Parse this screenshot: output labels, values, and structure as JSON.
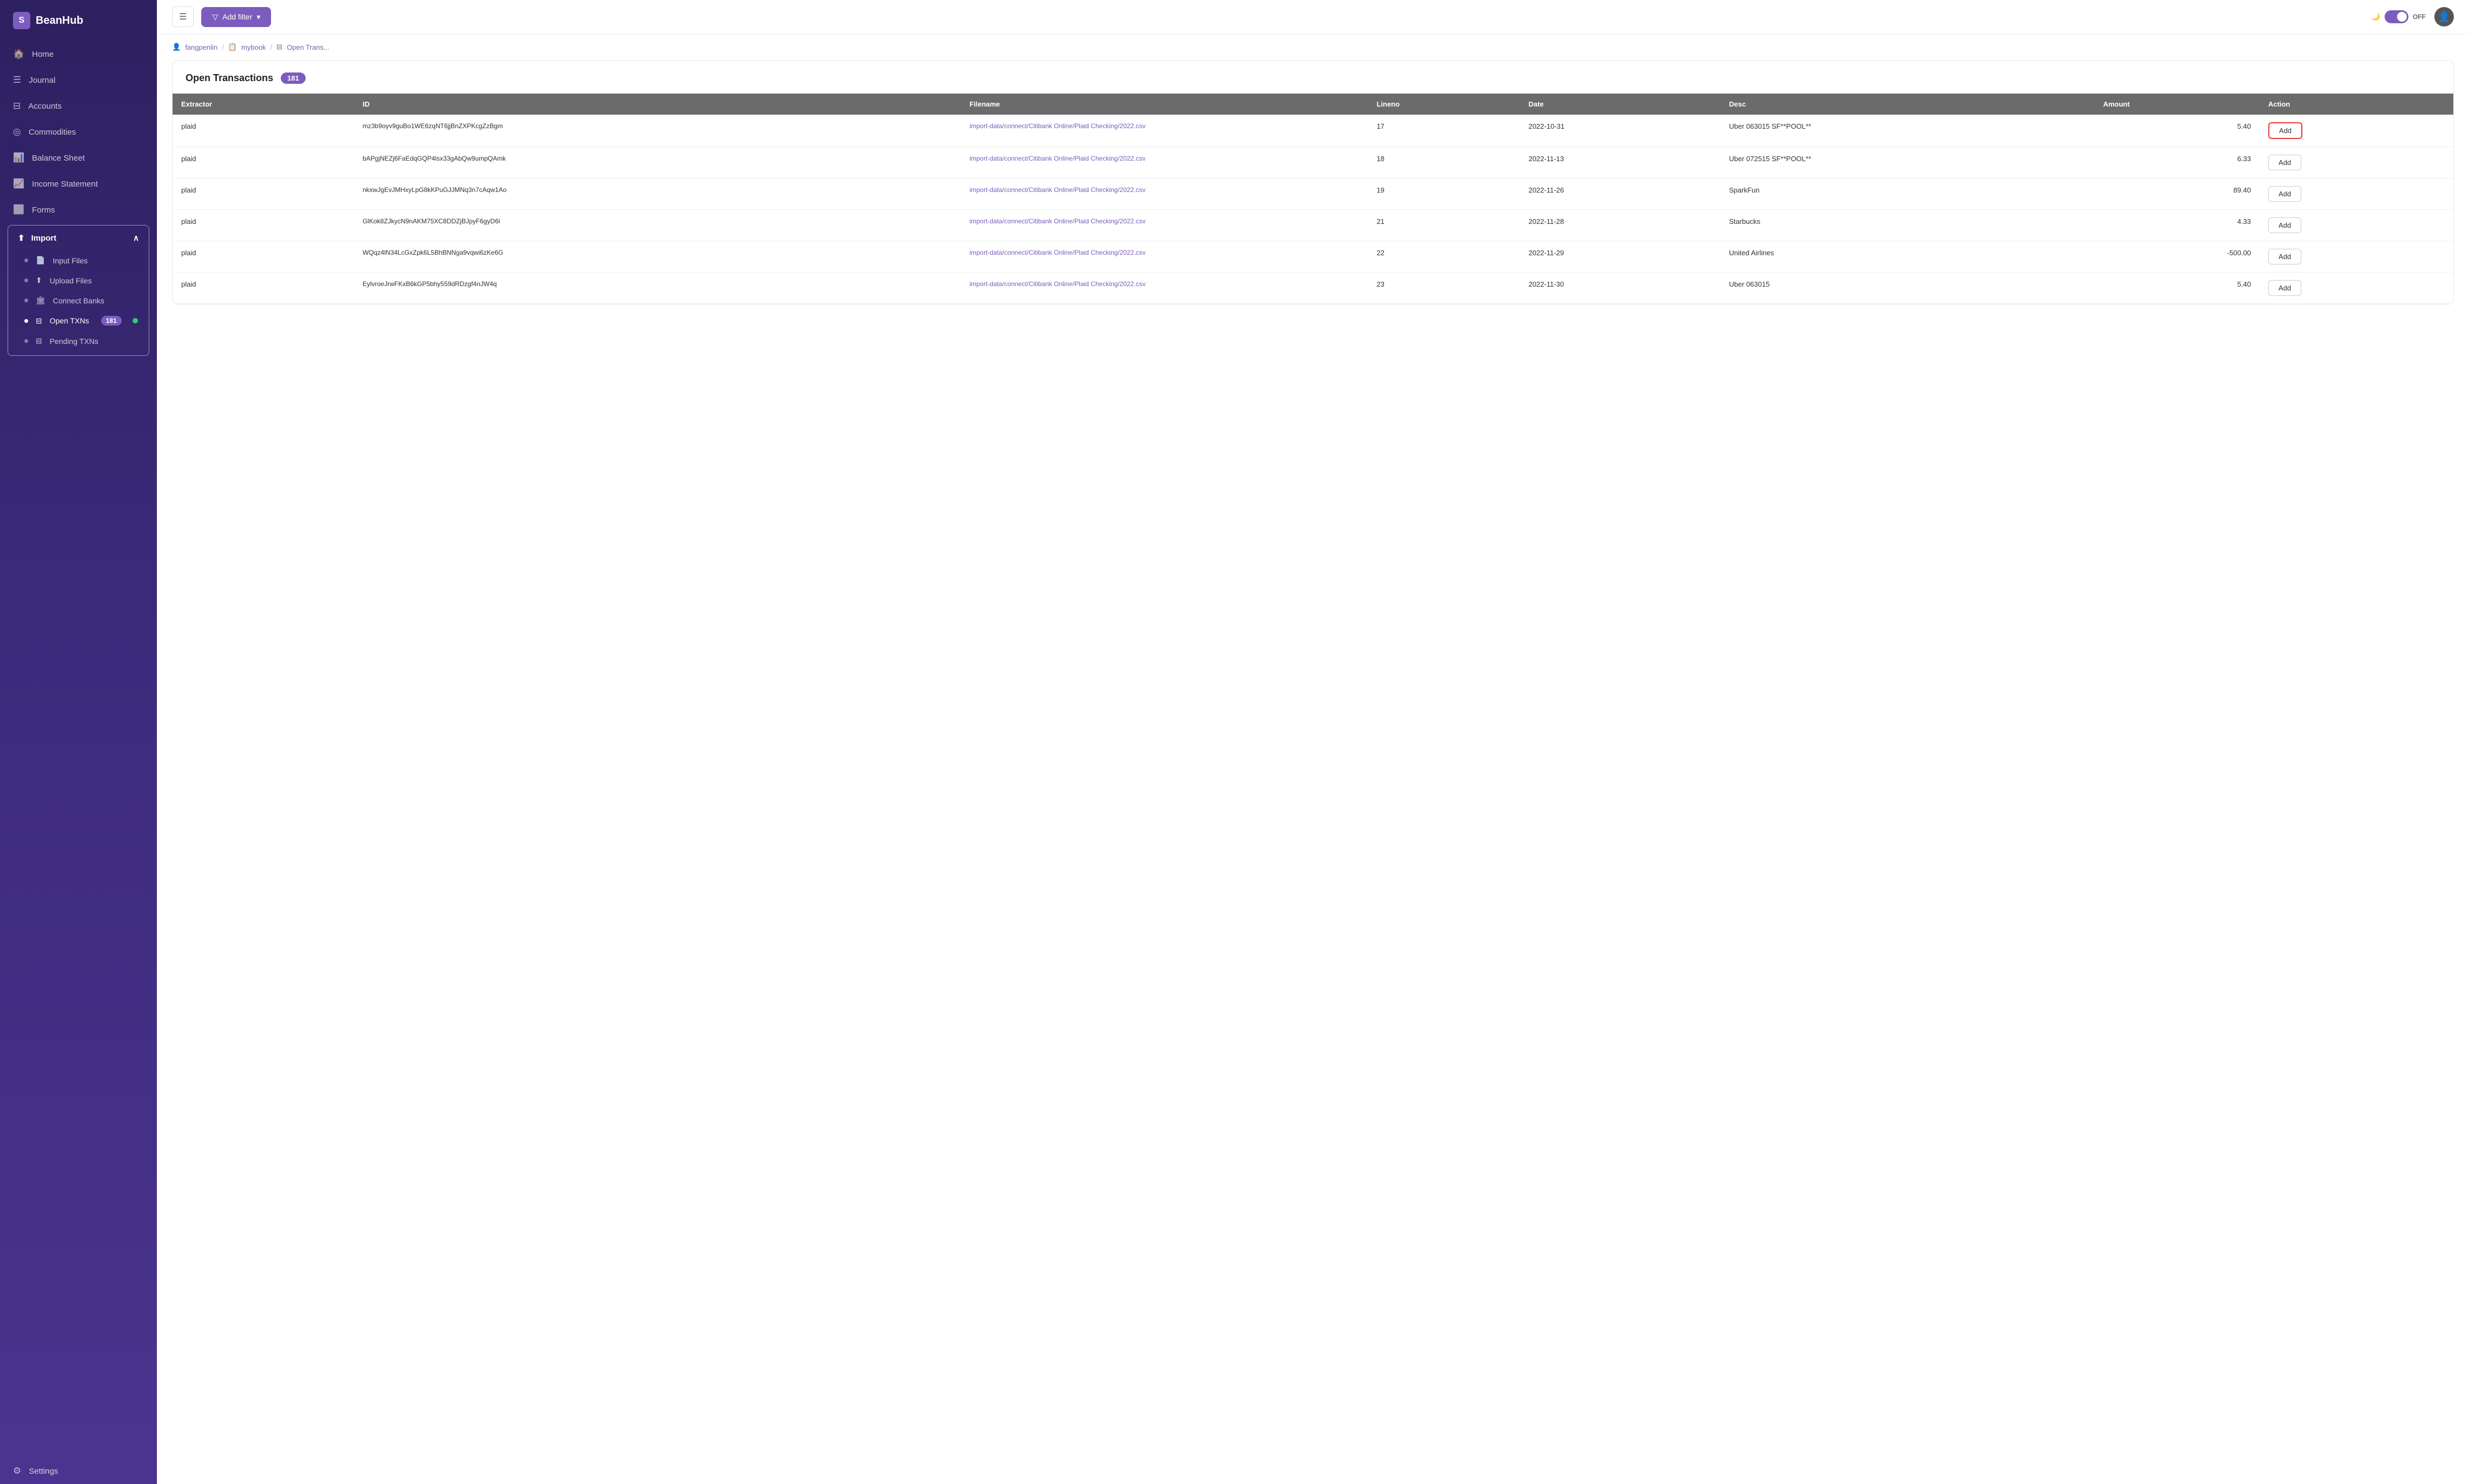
{
  "app": {
    "name": "BeanHub"
  },
  "sidebar": {
    "nav_items": [
      {
        "id": "home",
        "label": "Home",
        "icon": "🏠"
      },
      {
        "id": "journal",
        "label": "Journal",
        "icon": "☰"
      },
      {
        "id": "accounts",
        "label": "Accounts",
        "icon": "⊟"
      },
      {
        "id": "commodities",
        "label": "Commodities",
        "icon": "◎"
      },
      {
        "id": "balance-sheet",
        "label": "Balance Sheet",
        "icon": "📊"
      },
      {
        "id": "income-statement",
        "label": "Income Statement",
        "icon": "📈"
      },
      {
        "id": "forms",
        "label": "Forms",
        "icon": "⬜"
      }
    ],
    "import": {
      "label": "Import",
      "icon": "⬆",
      "sub_items": [
        {
          "id": "input-files",
          "label": "Input Files",
          "icon": "📄"
        },
        {
          "id": "upload-files",
          "label": "Upload Files",
          "icon": "⬆"
        },
        {
          "id": "connect-banks",
          "label": "Connect Banks",
          "icon": "🏛"
        },
        {
          "id": "open-txns",
          "label": "Open TXNs",
          "badge": "181",
          "active": true
        },
        {
          "id": "pending-txns",
          "label": "Pending TXNs",
          "icon": "⊟"
        }
      ]
    },
    "settings": {
      "label": "Settings",
      "icon": "⚙"
    }
  },
  "topbar": {
    "menu_icon": "☰",
    "filter_btn": "Add filter",
    "toggle_label": "OFF",
    "moon_icon": "🌙"
  },
  "breadcrumb": {
    "user": "fangpenlin",
    "book": "mybook",
    "page": "Open Trans..."
  },
  "page": {
    "title": "Open Transactions",
    "count": "181"
  },
  "table": {
    "headers": [
      "Extractor",
      "ID",
      "Filename",
      "Lineno",
      "Date",
      "Desc",
      "Amount",
      "Action"
    ],
    "rows": [
      {
        "extractor": "plaid",
        "id": "mz3b9oyv9guBo1WE6zqNT6jjBnZXPKcgZzBgm",
        "filename": "import-data/connect/Citibank Online/Plaid Checking/2022.csv",
        "lineno": "17",
        "date": "2022-10-31",
        "desc": "Uber 063015 SF**POOL**",
        "amount": "5.40",
        "action": "Add",
        "highlighted": true
      },
      {
        "extractor": "plaid",
        "id": "bAPgjNEZj6FaEdqGQP4lsx33gAbQw9umpQAmk",
        "filename": "import-data/connect/Citibank Online/Plaid Checking/2022.csv",
        "lineno": "18",
        "date": "2022-11-13",
        "desc": "Uber 072515 SF**POOL**",
        "amount": "6.33",
        "action": "Add",
        "highlighted": false
      },
      {
        "extractor": "plaid",
        "id": "nkxwJgEvJMHxyLpG8kKPuGJJMNq3n7cAqw1Ao",
        "filename": "import-data/connect/Citibank Online/Plaid Checking/2022.csv",
        "lineno": "19",
        "date": "2022-11-26",
        "desc": "SparkFun",
        "amount": "89.40",
        "action": "Add",
        "highlighted": false
      },
      {
        "extractor": "plaid",
        "id": "GlKok8ZJkycN9nAKM75XC8DDZjBJpyF6gyD6l",
        "filename": "import-data/connect/Citibank Online/Plaid Checking/2022.csv",
        "lineno": "21",
        "date": "2022-11-28",
        "desc": "Starbucks",
        "amount": "4.33",
        "action": "Add",
        "highlighted": false
      },
      {
        "extractor": "plaid",
        "id": "WQqz4lN34LcGxZpk6L5BhBNNga9vqwi6zKe6G",
        "filename": "import-data/connect/Citibank Online/Plaid Checking/2022.csv",
        "lineno": "22",
        "date": "2022-11-29",
        "desc": "United Airlines",
        "amount": "-500.00",
        "action": "Add",
        "highlighted": false
      },
      {
        "extractor": "plaid",
        "id": "EylvroeJrwFKxB6kGP5bhy559dRDzgf4nJW4q",
        "filename": "import-data/connect/Citibank Online/Plaid Checking/2022.csv",
        "lineno": "23",
        "date": "2022-11-30",
        "desc": "Uber 063015",
        "amount": "5.40",
        "action": "Add",
        "highlighted": false
      }
    ]
  }
}
